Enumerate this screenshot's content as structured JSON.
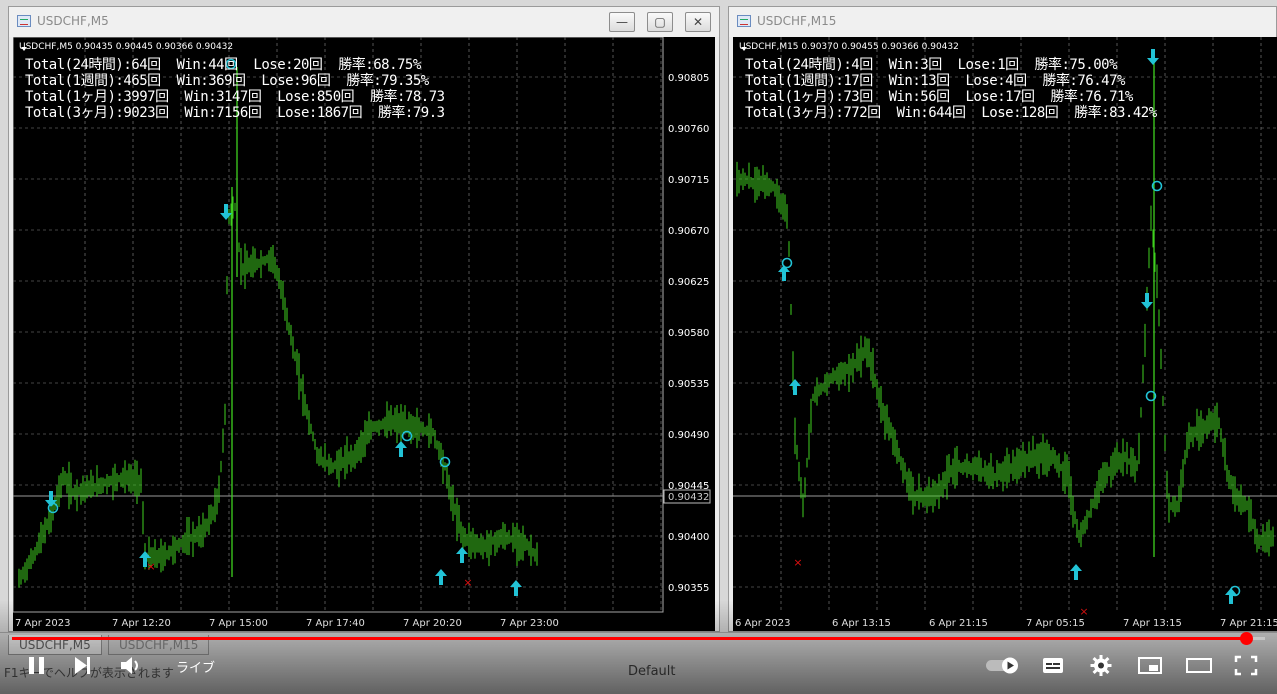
{
  "windows": [
    {
      "title": "USDCHF,M5",
      "symbol_line": "USDCHF,M5  0.90435 0.90445 0.90366 0.90432",
      "stats": [
        "Total(24時間):64回  Win:44回  Lose:20回  勝率:68.75%",
        "Total(1週間):465回  Win:369回  Lose:96回  勝率:79.35%",
        "Total(1ヶ月):3997回  Win:3147回  Lose:850回  勝率:78.73",
        "Total(3ヶ月):9023回  Win:7156回  Lose:1867回  勝率:79.3"
      ],
      "price_labels": [
        "0.90805",
        "0.90760",
        "0.90715",
        "0.90670",
        "0.90625",
        "0.90580",
        "0.90535",
        "0.90490",
        "0.90445",
        "0.90400",
        "0.90355"
      ],
      "current_price": "0.90432",
      "time_labels": [
        "7 Apr 2023",
        "7 Apr 12:20",
        "7 Apr 15:00",
        "7 Apr 17:40",
        "7 Apr 20:20",
        "7 Apr 23:00"
      ],
      "buttons": {
        "minimize": "—",
        "restore": "▢",
        "close": "✕"
      }
    },
    {
      "title": "USDCHF,M15",
      "symbol_line": "USDCHF,M15  0.90370 0.90455 0.90366 0.90432",
      "stats": [
        "Total(24時間):4回  Win:3回  Lose:1回  勝率:75.00%",
        "Total(1週間):17回  Win:13回  Lose:4回  勝率:76.47%",
        "Total(1ヶ月):73回  Win:56回  Lose:17回  勝率:76.71%",
        "Total(3ヶ月):772回  Win:644回  Lose:128回  勝率:83.42%"
      ],
      "time_labels": [
        "6 Apr 2023",
        "6 Apr 13:15",
        "6 Apr 21:15",
        "7 Apr 05:15",
        "7 Apr 13:15",
        "7 Apr 21:15"
      ]
    }
  ],
  "tabs": [
    "USDCHF,M5",
    "USDCHF,M15"
  ],
  "status": {
    "help_text": "F1キーでヘルプが表示されます",
    "profile": "Default"
  },
  "player": {
    "live_label": "ライブ",
    "progress": 0.985
  },
  "colors": {
    "candle": "#3fd11f",
    "arrow": "#22c3d6",
    "loss_mark": "#e01010",
    "progress": "#ff0000"
  },
  "icons": [
    "pause-icon",
    "next-icon",
    "volume-icon",
    "autoplay-toggle-icon",
    "subtitles-icon",
    "settings-icon",
    "miniplayer-icon",
    "theater-icon",
    "fullscreen-icon"
  ]
}
